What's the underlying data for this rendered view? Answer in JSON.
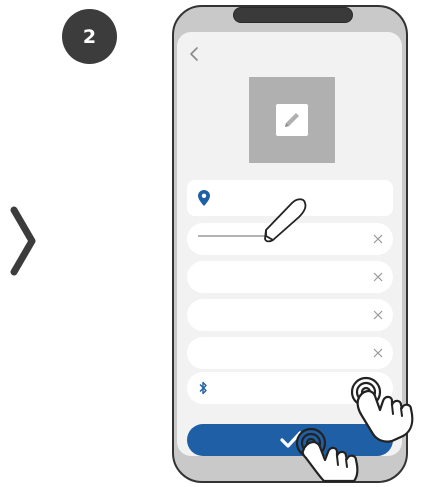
{
  "step": {
    "number": "2"
  },
  "colors": {
    "badge": "#3c3c3c",
    "accent_blue": "#1f5fa6",
    "phone_body": "#c9c9c9",
    "screen_bg": "#f2f2f2",
    "placeholder_gray": "#b0b0b0"
  },
  "icons": {
    "next": "chevron-right-icon",
    "back": "chevron-left-icon",
    "edit": "pencil-icon",
    "location": "location-pin-icon",
    "clear": "close-icon",
    "bluetooth": "bluetooth-icon",
    "confirm": "checkmark-icon",
    "stylus": "pen-icon",
    "gesture": "tap-hand-icon"
  },
  "form": {
    "fields": [
      {
        "type": "location",
        "value": ""
      },
      {
        "type": "text",
        "value": "",
        "state": "being-filled"
      },
      {
        "type": "text",
        "value": ""
      },
      {
        "type": "text",
        "value": ""
      },
      {
        "type": "text",
        "value": ""
      },
      {
        "type": "bluetooth",
        "value": "",
        "state": "tapped"
      }
    ]
  }
}
